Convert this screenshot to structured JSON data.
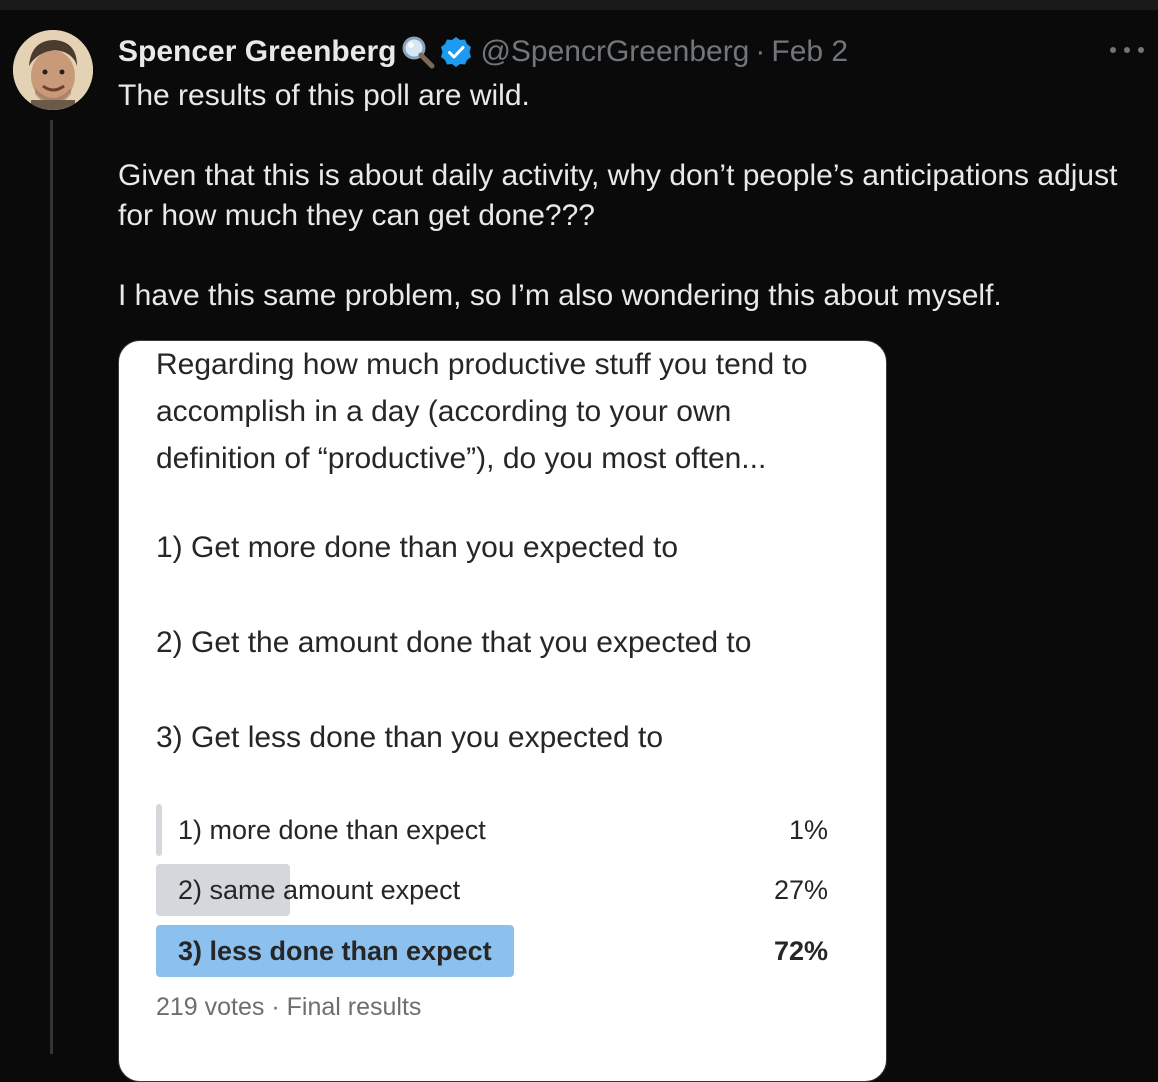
{
  "tweet": {
    "display_name": "Spencer Greenberg",
    "handle": "@SpencrGreenberg",
    "separator": "·",
    "date": "Feb 2",
    "paragraphs": [
      "The results of this poll are wild.",
      "Given that this is about daily activity, why don’t people’s anticipations adjust for how much they can get done???",
      "I have this same problem, so I’m also wondering this about myself."
    ],
    "icons": {
      "search": "magnifying-glass-icon",
      "verified": "verified-badge-icon",
      "more": "more-options-icon",
      "avatar": "avatar"
    },
    "colors": {
      "verified_blue": "#1d9bf0",
      "muted_text": "#71767b"
    }
  },
  "poll_image": {
    "question": "Regarding how much productive stuff you tend to accomplish in a day (according to your own definition of “productive”), do you most often...",
    "options": [
      "1) Get more done than you expected to",
      "2) Get the amount done that you expected to",
      "3) Get less done than you expected to"
    ],
    "results": [
      {
        "label": "1) more done than expect",
        "pct_text": "1%",
        "fraction": 0.01,
        "winner": false
      },
      {
        "label": "2) same amount expect",
        "pct_text": "27%",
        "fraction": 0.27,
        "winner": false
      },
      {
        "label": "3) less done than expect",
        "pct_text": "72%",
        "fraction": 0.72,
        "winner": true
      }
    ],
    "footer": "219 votes · Final results",
    "colors": {
      "bar_default": "#d4d7db",
      "bar_winner": "#8cc0ef"
    }
  }
}
